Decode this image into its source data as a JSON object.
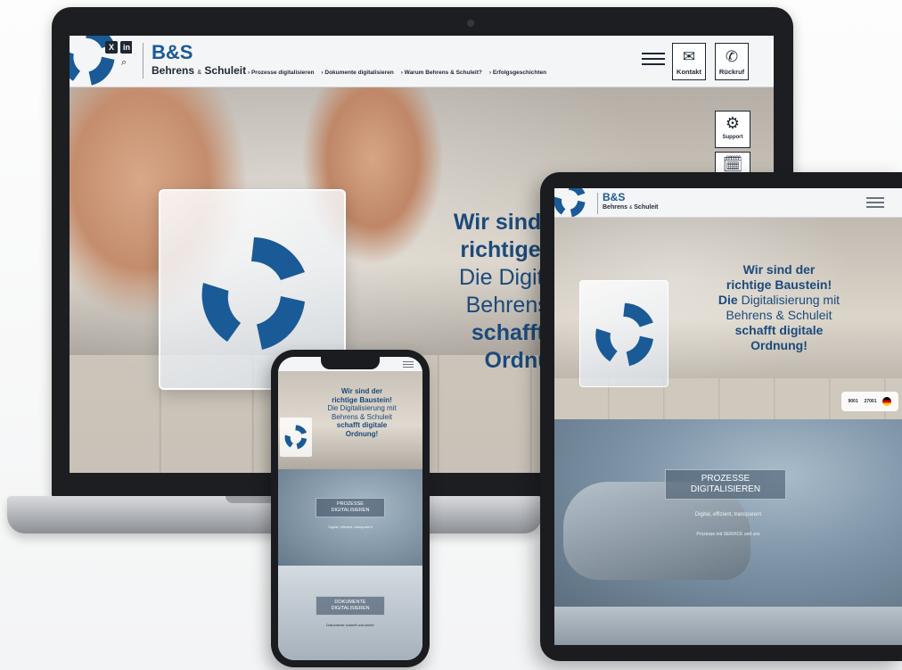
{
  "laptop": {
    "brand": "B&S",
    "brand_sub_a": "Behrens",
    "brand_sub_amp": "&",
    "brand_sub_b": "Schuleit",
    "social": [
      "X",
      "in"
    ],
    "nav": [
      "› Prozesse digitalisieren",
      "› Dokumente digitalisieren",
      "› Warum Behrens & Schuleit?",
      "› Erfolgsgeschichten"
    ],
    "kontakt_label": "Kontakt",
    "rueckruf_label": "Rückruf",
    "support_label": "Support",
    "headline": {
      "line1": "Wir sind der",
      "line2": "richtige Ba",
      "line3": "Die Digitalis",
      "line4": "Behrens &",
      "line5": "schafft d",
      "line6": "Ordnu"
    }
  },
  "tablet": {
    "brand": "B&S",
    "brand_sub_a": "Behrens",
    "brand_sub_amp": "&",
    "brand_sub_b": "Schuleit",
    "headline": {
      "line1": "Wir sind der",
      "line2": "richtige Baustein!",
      "line3a": "Die",
      "line3b": "Digitalisierung mit",
      "line4": "Behrens & Schuleit",
      "line5": "schafft digitale",
      "line6": "Ordnung!"
    },
    "badge": [
      "9001",
      "27001"
    ],
    "card_title_1": "PROZESSE",
    "card_title_2": "DIGITALISIEREN",
    "card_sub": "Digital, effizient, transparent",
    "card_sub2": "Prozesse mit SERVICE und uns"
  },
  "phone": {
    "headline": {
      "line1": "Wir sind der",
      "line2": "richtige Baustein!",
      "line3": "Die Digitalisierung mit",
      "line4": "Behrens & Schuleit",
      "line5": "schafft digitale",
      "line6": "Ordnung!"
    },
    "card1_a": "PROZESSE",
    "card1_b": "DIGITALISIEREN",
    "card1_sub": "Digital, effizient, transparent",
    "card2_a": "DOKUMENTE",
    "card2_b": "DIGITALISIEREN",
    "card2_sub": "Dokumente schnell und sicher"
  },
  "colors": {
    "brand_blue": "#1a5a96",
    "headline_navy": "#1c4a7a",
    "dark": "#1d2733"
  },
  "icons": [
    "envelope-icon",
    "phone-icon",
    "gear-icon",
    "calendar-icon",
    "search-icon",
    "menu-icon",
    "logo-swirl-icon"
  ]
}
